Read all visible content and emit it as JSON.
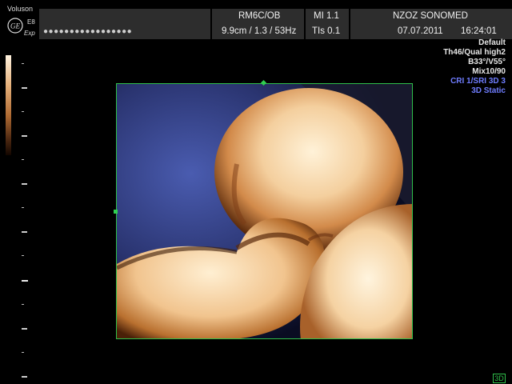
{
  "header": {
    "brand": "Voluson",
    "model": "E8",
    "mode_label": "Exp",
    "probe": "RM6C/OB",
    "mi": "MI  1.1",
    "institution": "NZOZ SONOMED",
    "dots": "●●●●●●●●●●●●●●●●●",
    "depth": "9.9cm / 1.3 / 53Hz",
    "tis": "TIs  0.1",
    "date": "07.07.2011",
    "time": "16:24:01"
  },
  "params": {
    "preset": "Default",
    "quality": "Th46/Qual high2",
    "angles": "B33°/V55°",
    "mix": "Mix10/90",
    "cri": "CRI 1/SRI 3D 3",
    "mode": "3D Static"
  },
  "footer": {
    "mode_badge": "3D"
  },
  "colors": {
    "accent_green": "#2fbf4a",
    "header_bg": "#2d2d2d",
    "param_blue": "#6f7dff"
  }
}
